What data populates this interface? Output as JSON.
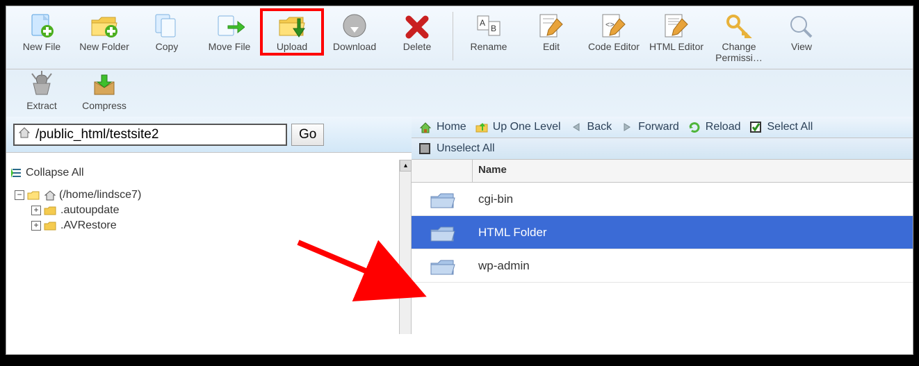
{
  "toolbar": {
    "row1": [
      {
        "id": "new-file",
        "label": "New File"
      },
      {
        "id": "new-folder",
        "label": "New Folder"
      },
      {
        "id": "copy",
        "label": "Copy"
      },
      {
        "id": "move-file",
        "label": "Move File"
      },
      {
        "id": "upload",
        "label": "Upload",
        "highlighted": true
      },
      {
        "id": "download",
        "label": "Download"
      },
      {
        "id": "delete",
        "label": "Delete"
      },
      {
        "sep": true
      },
      {
        "id": "rename",
        "label": "Rename"
      },
      {
        "id": "edit",
        "label": "Edit"
      },
      {
        "id": "code-editor",
        "label": "Code Editor"
      },
      {
        "id": "html-editor",
        "label": "HTML Editor"
      },
      {
        "id": "change-perms",
        "label": "Change Permissi…"
      },
      {
        "id": "view",
        "label": "View"
      }
    ],
    "row2": [
      {
        "id": "extract",
        "label": "Extract"
      },
      {
        "id": "compress",
        "label": "Compress"
      }
    ]
  },
  "path": {
    "value": "/public_html/testsite2",
    "go": "Go"
  },
  "left": {
    "collapse": "Collapse All",
    "root": "(/home/lindsce7)",
    "children": [
      {
        "name": ".autoupdate"
      },
      {
        "name": ".AVRestore"
      }
    ]
  },
  "actionbar": {
    "home": "Home",
    "up": "Up One Level",
    "back": "Back",
    "forward": "Forward",
    "reload": "Reload",
    "selectall": "Select All",
    "unselectall": "Unselect All"
  },
  "table": {
    "header": "Name",
    "rows": [
      {
        "name": "cgi-bin",
        "selected": false
      },
      {
        "name": "HTML Folder",
        "selected": true
      },
      {
        "name": "wp-admin",
        "selected": false
      }
    ]
  }
}
